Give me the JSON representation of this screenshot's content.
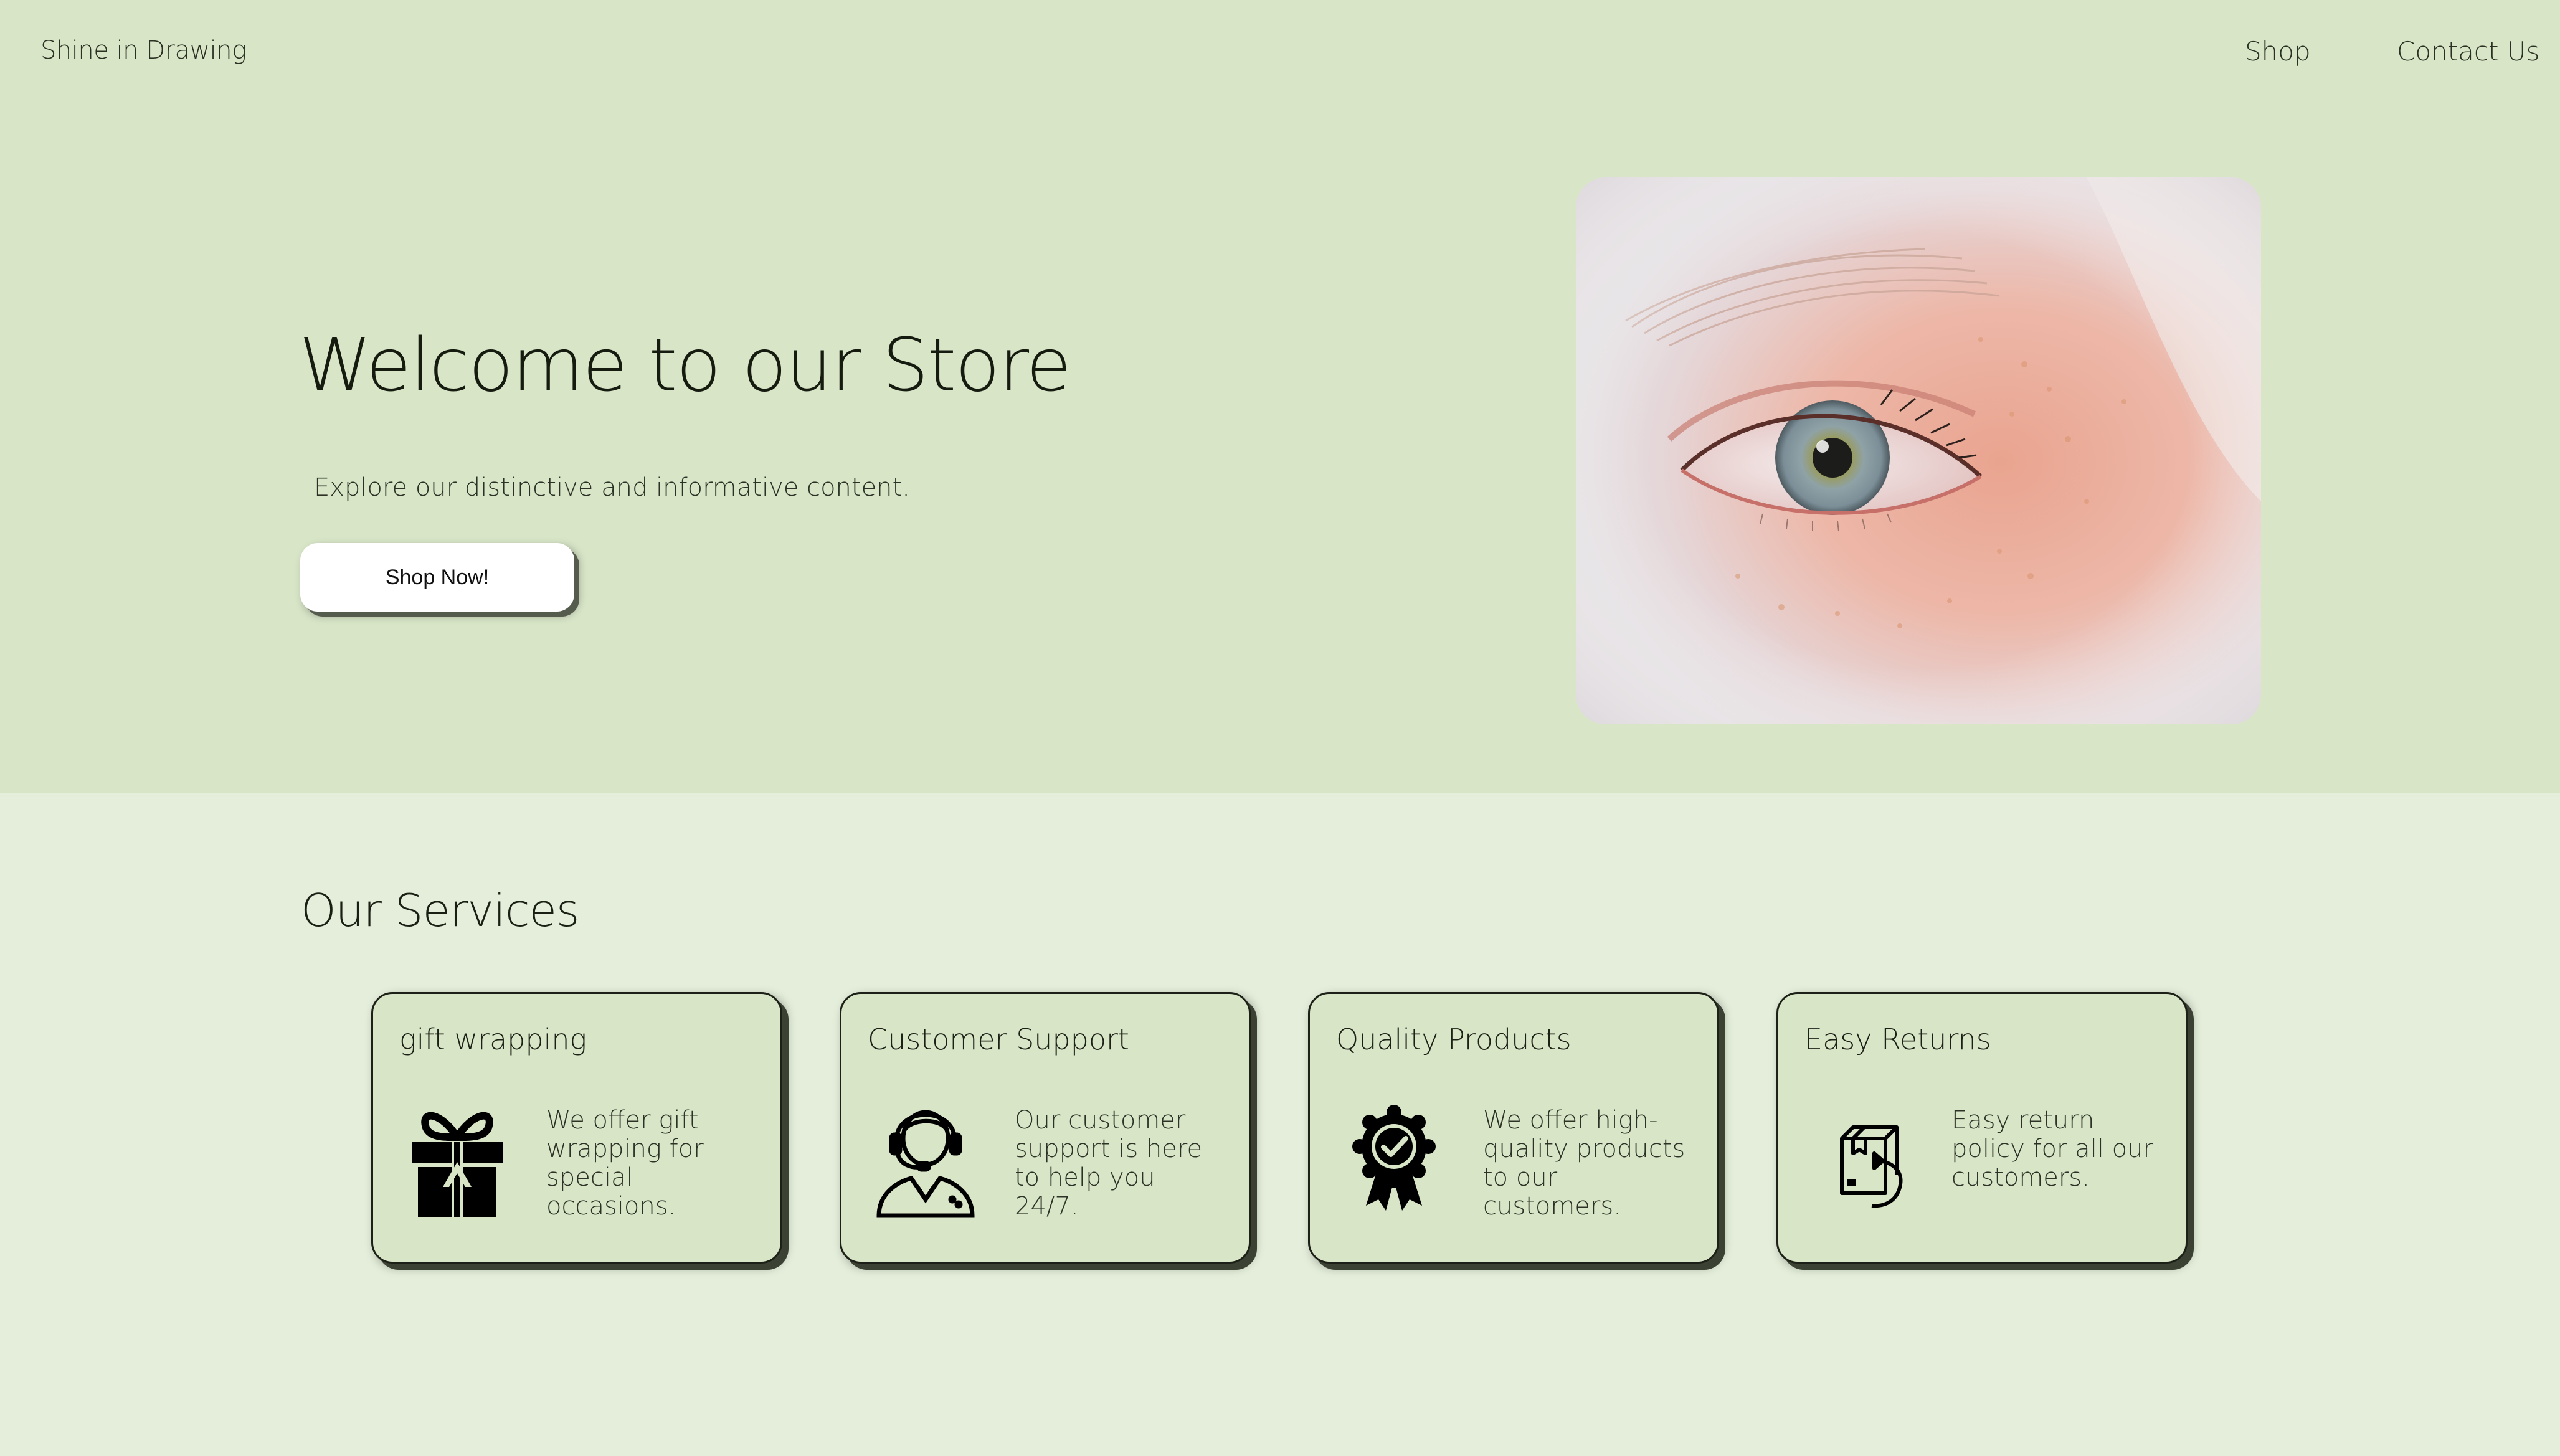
{
  "header": {
    "brand": "Shine in Drawing",
    "nav": [
      {
        "label": "Shop"
      },
      {
        "label": "Contact Us"
      }
    ]
  },
  "hero": {
    "title": "Welcome to our Store",
    "subtitle": "Explore our distinctive and informative content.",
    "button_label": "Shop Now!",
    "image_icon": "eye-photo"
  },
  "services": {
    "title": "Our Services",
    "items": [
      {
        "title": "gift wrapping",
        "description": "We offer gift wrapping for special occasions.",
        "icon": "gift-icon"
      },
      {
        "title": "Customer Support",
        "description": "Our customer support is here to help you 24/7.",
        "icon": "headset-agent-icon"
      },
      {
        "title": "Quality Products",
        "description": "We offer high-quality products to our customers.",
        "icon": "quality-badge-icon"
      },
      {
        "title": "Easy Returns",
        "description": "Easy return policy for all our customers.",
        "icon": "return-box-icon"
      }
    ]
  },
  "colors": {
    "hero_background": "#d8e5c7",
    "page_background": "#e4eeda",
    "card_background": "#d8e5c7",
    "button_background": "#ffffff"
  }
}
